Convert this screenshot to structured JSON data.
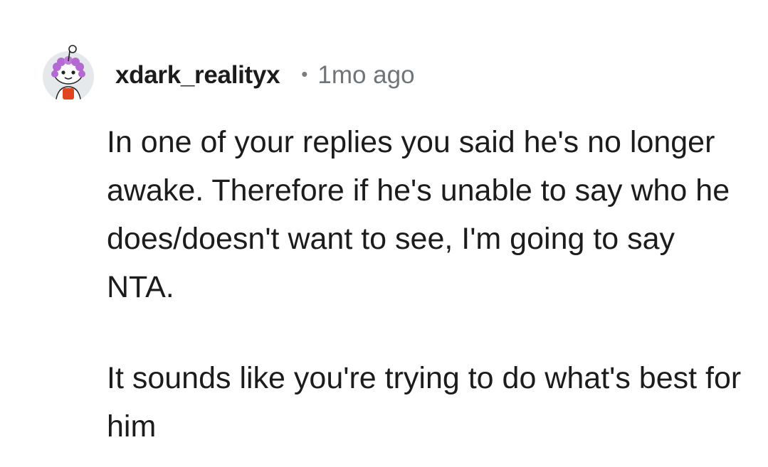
{
  "comment": {
    "author": "xdark_realityx",
    "separator": "•",
    "timestamp": "1mo ago",
    "avatar_icon": "snoo-avatar-icon",
    "paragraphs": [
      "In one of your replies you said he's no longer awake. Therefore if he's unable to say who he does/doesn't want to see, I'm going to say NTA.",
      "It sounds like you're trying to do what's best for him"
    ]
  },
  "colors": {
    "background": "#ffffff",
    "text": "#1c1c1c",
    "muted": "#6e7478",
    "avatar_hair": "#b46ad2",
    "avatar_shirt": "#e0451f"
  }
}
